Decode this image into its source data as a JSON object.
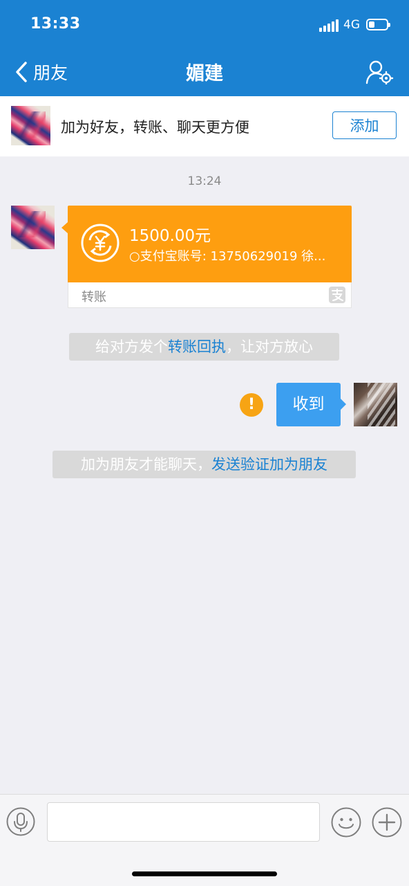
{
  "status_bar": {
    "time": "13:33",
    "network": "4G"
  },
  "nav": {
    "back_label": "朋友",
    "title": "媚建"
  },
  "banner": {
    "text": "加为好友，转账、聊天更方便",
    "add_label": "添加"
  },
  "chat": {
    "timestamp": "13:24",
    "transfer": {
      "amount": "1500.00元",
      "desc": "○支付宝账号: 13750629019 徐...",
      "label": "转账"
    },
    "receipt_prompt": {
      "prefix": "给对方发个",
      "link": "转账回执",
      "suffix": "，让对方放心"
    },
    "sent_message": "收到",
    "friend_prompt": {
      "prefix": "加为朋友才能聊天，",
      "link": "发送验证加为朋友"
    }
  },
  "input": {
    "placeholder": ""
  },
  "colors": {
    "header": "#1b82d2",
    "transfer": "#fe9e10",
    "bubble": "#3c9ff0",
    "warning": "#f7a414"
  }
}
